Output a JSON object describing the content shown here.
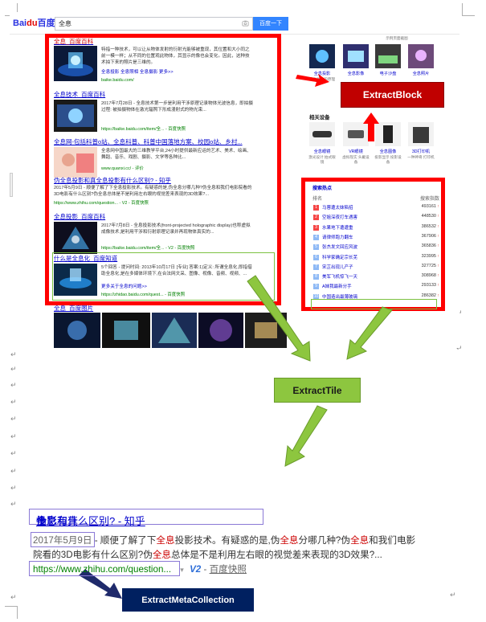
{
  "search": {
    "logo": {
      "part1": "Bai",
      "part2": "du",
      "part3": "百度"
    },
    "query": "全息",
    "button": "百度一下"
  },
  "results": [
    {
      "title": "全息_百度百科",
      "snippet": "特指一种技术，可以让从物体发射的衍射光能够被重现，其位置和大小同之前一模一样；从不同的位置观此物体，其显示的像也会变化。因此，这种技术拍下来的照片是三维的。",
      "links": [
        "全息投影",
        "全息照相",
        "全息摄影",
        "更多>>"
      ],
      "url": "baike.baidu.com/"
    },
    {
      "title": "全息技术_百度百科",
      "snippet": "2017年7月28日 - 全息技术第一步是利用干涉原理记录物体光波信息，即拍摄过程: 被拍摄物体在激光辐照下形成漫射式的物光束...",
      "links": [
        "全息投影技术",
        "更多>>"
      ],
      "url": "https://baike.baidu.com/item/全... - 百度快照"
    },
    {
      "title": "全息网-包括科普o站、全息科普、科普中国落地方案、校园o站、乡村...",
      "snippet": "全息网中国最大的三维教学平台,24小时提供最新应运的艺术、美术、绘画、舞蹈、音乐、戏剧、摄影、文学等各种比...",
      "url": "www.quanxi.cc/ - 评价"
    },
    {
      "title": "伪全息投影和真全息投影有什么区别? - 知乎",
      "snippet": "2017年5月9日 - 顺便了解了下全息投影技术。有疑惑的是,伪全息分哪几种?伪全息和我们电影院看的3D电影有什么区别?伪全息总体是不是利用左右眼的视觉差来表现的3D效果?...",
      "url": "https://www.zhihu.com/question... - V2 - 百度快照"
    },
    {
      "title": "全息投影_百度百科",
      "snippet": "2017年7月8日 - 全息投影技术(front-projected holographic display)也称虚拟成像技术,是利用干涉和衍射原理记录并再现物体真实的...",
      "links": [
        "全息投影技术",
        "更多>>"
      ],
      "url": "https://baike.baidu.com/item/全... - V2 - 百度快照"
    },
    {
      "title": "什么是全息化_百度知道",
      "snippet": "5个回答 - 提问时间: 2013年10月17日 [专业] 答案:1)定义: 所谓全息化,即指借助全息化,是在多媒体环境下,在合法网文采、图像、视像、音频、视频、...",
      "links": [
        "更多关于全息的问题>>"
      ],
      "url": "https://zhidao.baidu.com/quest... - 百度快照"
    },
    {
      "title": "全息_百度图片"
    }
  ],
  "sidebar": {
    "top_note": "示例页面截图",
    "top_items": [
      {
        "caption": "全息投影",
        "note": "视觉显示的原理"
      },
      {
        "caption": "全息影像",
        "note": ""
      },
      {
        "caption": "电子沙盘",
        "note": ""
      },
      {
        "caption": "全息照片",
        "note": ""
      }
    ],
    "devices_heading": "相关设备",
    "device_items": [
      {
        "caption": "全息眼镜",
        "note": "激光设计 拍式眼镜"
      },
      {
        "caption": "VR眼镜",
        "note": "虚拟现实 头戴设备"
      },
      {
        "caption": "全息图像",
        "note": "投影显示 投影设备"
      },
      {
        "caption": "3D打印机",
        "note": "一种神奇 打印机"
      }
    ],
    "ranking": {
      "title": "搜索热点",
      "col_name": "排名",
      "col_value": "搜索指数",
      "rows": [
        {
          "rank": "1",
          "name": "马蓉遭太妹陷招",
          "value": "493161"
        },
        {
          "rank": "2",
          "name": "空姐深夜打车遇害",
          "value": "448530"
        },
        {
          "rank": "3",
          "name": "水果地下遭遭重",
          "value": "386532"
        },
        {
          "rank": "4",
          "name": "请律师跑力翻车",
          "value": "367906"
        },
        {
          "rank": "5",
          "name": "张杰发文回应风波",
          "value": "365836"
        },
        {
          "rank": "6",
          "name": "科学家确定宗长芜",
          "value": "323995"
        },
        {
          "rank": "7",
          "name": "宋芷出现儿产子",
          "value": "327725"
        },
        {
          "rank": "8",
          "name": "美军飞机惊飞一天",
          "value": "308968"
        },
        {
          "rank": "9",
          "name": "A妹我最新分手",
          "value": "293133"
        },
        {
          "rank": "10",
          "name": "中国造出最薄玻璃",
          "value": "286382"
        }
      ]
    }
  },
  "callouts": {
    "block": "ExtractBlock",
    "tile": "ExtractTile",
    "meta": "ExtractMetaCollection"
  },
  "zoom": {
    "title_pre": "伪",
    "title_em1": "全息",
    "title_mid": "投影和真",
    "title_em2": "全息",
    "title_post": "投影有什么区别? - 知乎",
    "date": "2017年5月9日",
    "line1_a": " - 顺便了解了下",
    "line1_em1": "全息",
    "line1_b": "投影技术。有疑惑的是,伪",
    "line1_em2": "全息",
    "line1_c": "分哪几种?伪",
    "line1_em3": "全息",
    "line1_d": "和我们电影",
    "line2_a": "院看的3D电影有什么区别?伪",
    "line2_em": "全息",
    "line2_b": "总体是不是利用左右眼的视觉差来表现的3D效果?...",
    "url": "https://www.zhihu.com/question...",
    "badge": "V2",
    "snapshot": "百度快照"
  },
  "colors": {
    "red_box": "#ff0000",
    "green_box": "#7cc242",
    "purple_box": "#8b79d6",
    "block_callout_bg": "#c00000",
    "tile_callout_bg": "#8dc63f",
    "meta_callout_bg": "#002060",
    "link_blue": "#0000cc",
    "baidu_button": "#3385ff"
  }
}
